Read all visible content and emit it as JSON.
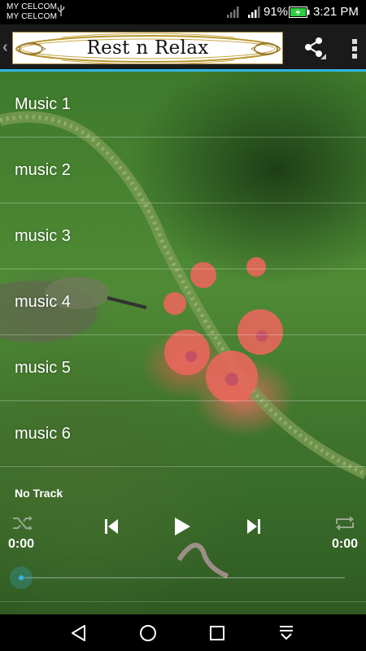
{
  "status_bar": {
    "carrier_1": "MY CELCOM",
    "carrier_2": "MY CELCOM",
    "battery_percent": "91%",
    "time": "3:21 PM"
  },
  "action_bar": {
    "logo_text": "Rest n Relax",
    "icons": [
      "back-chevron-icon",
      "share-icon",
      "overflow-menu-icon"
    ]
  },
  "music_list": [
    {
      "label": "Music 1"
    },
    {
      "label": "music 2"
    },
    {
      "label": "music 3"
    },
    {
      "label": "music 4"
    },
    {
      "label": "music 5"
    },
    {
      "label": "music 6"
    }
  ],
  "player": {
    "track_name": "No Track",
    "current_time": "0:00",
    "total_time": "0:00",
    "progress": 0,
    "icons": [
      "shuffle-icon",
      "previous-icon",
      "play-icon",
      "next-icon",
      "repeat-icon"
    ]
  },
  "colors": {
    "accent": "#33b5e5",
    "action_bar": "#1a1a1a",
    "battery": "#2ecc40"
  },
  "nav_bar": {
    "icons": [
      "back-triangle-icon",
      "home-circle-icon",
      "recents-square-icon",
      "notifications-pulldown-icon"
    ]
  }
}
